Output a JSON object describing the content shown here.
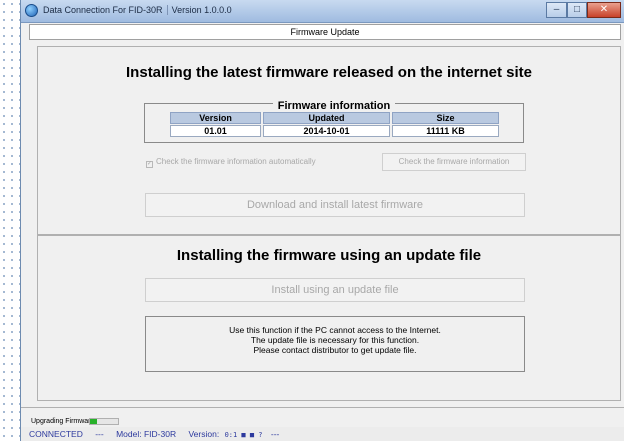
{
  "window": {
    "title": "Data Connection For FID-30R",
    "version_label": "Version 1.0.0.0",
    "controls": {
      "minimize": "–",
      "maximize": "□",
      "close": "✕"
    }
  },
  "page": {
    "header": "Firmware Update"
  },
  "internet_section": {
    "heading": "Installing the latest firmware released on the internet site",
    "firmware_info": {
      "title": "Firmware information",
      "columns": [
        "Version",
        "Updated",
        "Size"
      ],
      "values": [
        "01.01",
        "2014-10-01",
        "11111 KB"
      ]
    },
    "auto_check": {
      "label": "Check the firmware information automatically",
      "checked": true,
      "enabled": false
    },
    "check_button": "Check the firmware information",
    "download_button": "Download and install latest firmware"
  },
  "file_section": {
    "heading": "Installing the firmware using an update file",
    "install_button": "Install using an update file",
    "info_lines": [
      "Use this function if the PC cannot access to the Internet.",
      "The update file is necessary for this function.",
      "Please contact distributor to get update file."
    ]
  },
  "progress": {
    "label": "Upgrading Firmware ...",
    "fraction": 0.25
  },
  "statusbar": {
    "connection": "CONNECTED",
    "separator": "---",
    "model": "Model: FID-30R",
    "version_label": "Version:",
    "version_value": "0:1 ■ ■ ?",
    "trailing": "---"
  },
  "colors": {
    "accent": "#2d3a9e",
    "progress": "#27b12a",
    "header_cell": "#b9c9e0"
  }
}
